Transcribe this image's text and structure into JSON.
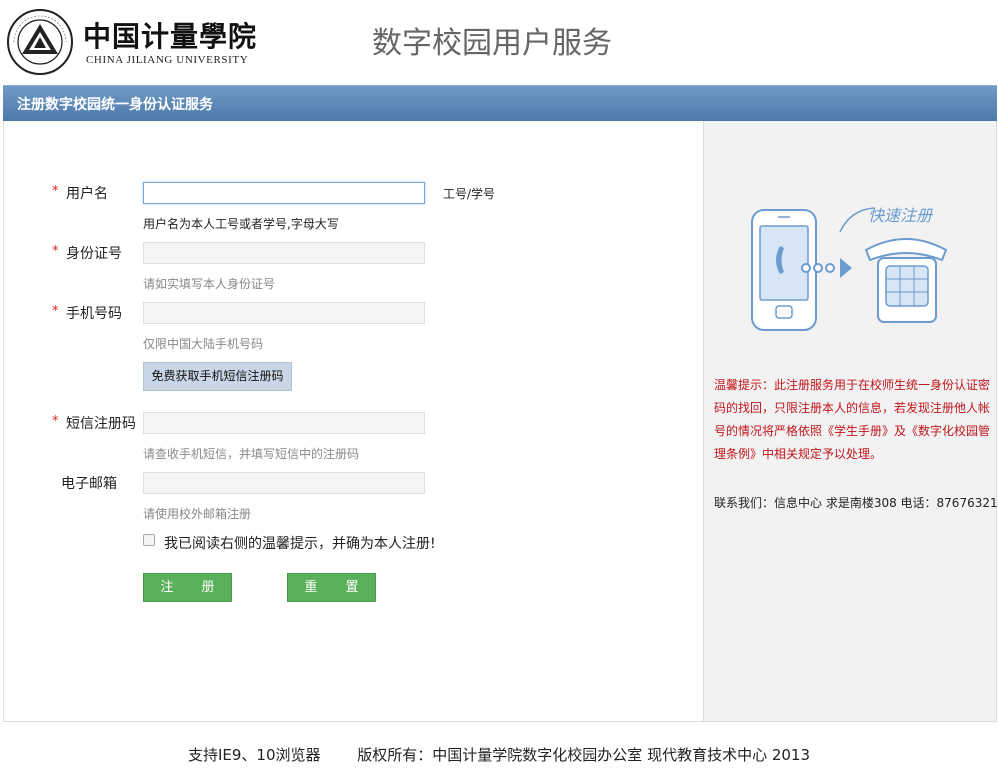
{
  "header": {
    "logo_cn": "中国计量學院",
    "logo_en": "CHINA JILIANG UNIVERSITY",
    "emblem_text": "CHINA JILIANG UNIVERSITY",
    "site_title": "数字校园用户服务"
  },
  "band": {
    "title": "注册数字校园统一身份认证服务"
  },
  "form": {
    "username": {
      "label": "用户名",
      "value": "",
      "suffix": "工号/学号",
      "hint": "用户名为本人工号或者学号,字母大写"
    },
    "idcard": {
      "label": "身份证号",
      "value": "",
      "hint": "请如实填写本人身份证号"
    },
    "phone": {
      "label": "手机号码",
      "value": "",
      "hint": "仅限中国大陆手机号码"
    },
    "sms_button": "免费获取手机短信注册码",
    "sms_code": {
      "label": "短信注册码",
      "value": "",
      "hint": "请查收手机短信，并填写短信中的注册码"
    },
    "email": {
      "label": "电子邮箱",
      "value": "",
      "hint": "请使用校外邮箱注册"
    },
    "agree_label": "我已阅读右侧的温馨提示，并确为本人注册!",
    "agree_checked": false,
    "register_button": "注 册",
    "reset_button": "重 置",
    "required_mark": "*"
  },
  "sidebar": {
    "illustration_caption": "快速注册",
    "tip": "温馨提示：此注册服务用于在校师生统一身份认证密码的找回，只限注册本人的信息，若发现注册他人帐号的情况将严格依照《学生手册》及《数字化校园管理条例》中相关规定予以处理。",
    "contact": "联系我们：信息中心 求是南楼308 电话：87676321"
  },
  "footer": {
    "browser_support": "支持IE9、10浏览器",
    "copyright": "版权所有：中国计量学院数字化校园办公室 现代教育技术中心 2013"
  },
  "colors": {
    "band_top": "#6f99c5",
    "band_bottom": "#4d79ab",
    "button_green": "#5bb05b",
    "tip_red": "#c0151b",
    "required_red": "#d22222"
  }
}
